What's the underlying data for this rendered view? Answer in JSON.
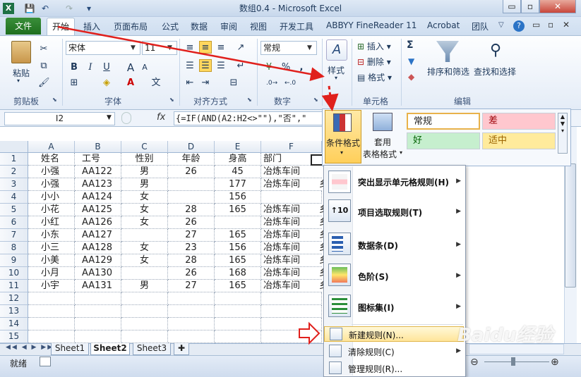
{
  "window": {
    "title": "数组0.4 - Microsoft Excel",
    "min": "▭",
    "max": "▫",
    "close": "✕"
  },
  "qat": {
    "save": "💾",
    "undo": "↶",
    "redo": "↷"
  },
  "tabs": {
    "file": "文件",
    "home": "开始",
    "insert": "插入",
    "layout": "页面布局",
    "formulas": "公式",
    "data": "数据",
    "review": "审阅",
    "view": "视图",
    "dev": "开发工具",
    "abbyy": "ABBYY FineReader 11",
    "acrobat": "Acrobat",
    "team": "团队"
  },
  "ribbon": {
    "paste": "粘贴",
    "clipboard": "剪贴板",
    "font_name": "宋体",
    "font_size": "11",
    "font": "字体",
    "bold": "B",
    "italic": "I",
    "underline": "U",
    "align": "对齐方式",
    "numfmt": "常规",
    "number": "数字",
    "pct": "%",
    "comma": ",",
    "style": "样式",
    "insert": "插入",
    "delete": "删除",
    "format": "格式",
    "cells": "单元格",
    "sum": "Σ",
    "sortfilter": "排序和筛选",
    "findselect": "查找和选择",
    "editing": "编辑"
  },
  "formula": {
    "cell": "I2",
    "fx": "fx",
    "text": "{=IF(AND(A2:H2<>\"\"),\"否\",\""
  },
  "gallery": {
    "cond_format": "条件格式",
    "apply": "套用",
    "table_format": "表格格式",
    "normal": "常规",
    "bad": "差",
    "good": "好",
    "neutral": "适中",
    "colors": {
      "normal_bg": "#ffffff",
      "bad_bg": "#ffc7ce",
      "good_bg": "#c6efce",
      "neutral_bg": "#ffeb9c",
      "bad_fg": "#9c0006",
      "good_fg": "#006100",
      "neutral_fg": "#9c6500"
    }
  },
  "menu": {
    "highlight": "突出显示单元格规则(H)",
    "topbottom": "项目选取规则(T)",
    "databar": "数据条(D)",
    "colorscale": "色阶(S)",
    "iconset": "图标集(I)",
    "newrule": "新建规则(N)...",
    "clear": "清除规则(C)",
    "manage": "管理规则(R)..."
  },
  "grid": {
    "columns": [
      "A",
      "B",
      "C",
      "D",
      "E",
      "F"
    ],
    "rows": [
      [
        "姓名",
        "工号",
        "性别",
        "年龄",
        "身高",
        "部门"
      ],
      [
        "小强",
        "AA122",
        "男",
        "26",
        "45",
        "冶炼车间"
      ],
      [
        "小强",
        "AA123",
        "男",
        "",
        "177",
        "冶炼车间"
      ],
      [
        "小小",
        "AA124",
        "女",
        "",
        "156",
        ""
      ],
      [
        "小花",
        "AA125",
        "女",
        "28",
        "165",
        "冶炼车间"
      ],
      [
        "小红",
        "AA126",
        "女",
        "26",
        "",
        "冶炼车间"
      ],
      [
        "小东",
        "AA127",
        "",
        "27",
        "165",
        "冶炼车间"
      ],
      [
        "小三",
        "AA128",
        "女",
        "23",
        "156",
        "冶炼车间"
      ],
      [
        "小美",
        "AA129",
        "女",
        "28",
        "165",
        "冶炼车间"
      ],
      [
        "小月",
        "AA130",
        "",
        "26",
        "168",
        "冶炼车间"
      ],
      [
        "小宇",
        "AA131",
        "男",
        "27",
        "165",
        "冶炼车间"
      ],
      [
        "",
        "",
        "",
        "",
        "",
        ""
      ],
      [
        "",
        "",
        "",
        "",
        "",
        ""
      ],
      [
        "",
        "",
        "",
        "",
        "",
        ""
      ],
      [
        "",
        "",
        "",
        "",
        "",
        ""
      ]
    ],
    "row_numbers": [
      "1",
      "2",
      "3",
      "4",
      "5",
      "6",
      "7",
      "8",
      "9",
      "10",
      "11",
      "12",
      "13",
      "14",
      "15"
    ],
    "overflow_glyph": "乡"
  },
  "sheets": [
    "Sheet1",
    "Sheet2",
    "Sheet3"
  ],
  "status": {
    "ready": "就绪"
  },
  "watermark": "Baidu经验"
}
